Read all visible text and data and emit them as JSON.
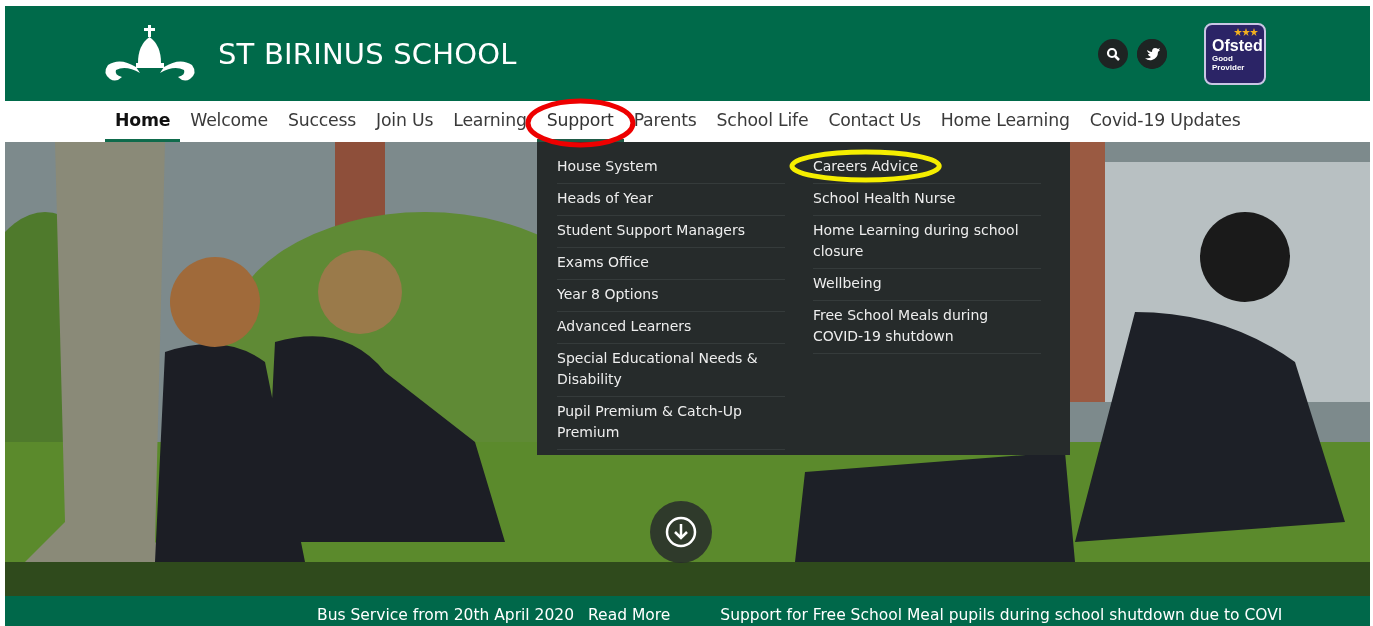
{
  "header": {
    "title": "ST BIRINUS SCHOOL",
    "badge": {
      "name": "Ofsted",
      "rating_line_1": "Good",
      "rating_line_2": "Provider"
    }
  },
  "nav": [
    {
      "label": "Home",
      "selected": true,
      "expanded": false
    },
    {
      "label": "Welcome",
      "selected": false,
      "expanded": false
    },
    {
      "label": "Success",
      "selected": false,
      "expanded": false
    },
    {
      "label": "Join Us",
      "selected": false,
      "expanded": false
    },
    {
      "label": "Learning",
      "selected": false,
      "expanded": false
    },
    {
      "label": "Support",
      "selected": false,
      "expanded": true
    },
    {
      "label": "Parents",
      "selected": false,
      "expanded": false
    },
    {
      "label": "School Life",
      "selected": false,
      "expanded": false
    },
    {
      "label": "Contact Us",
      "selected": false,
      "expanded": false
    },
    {
      "label": "Home Learning",
      "selected": false,
      "expanded": false
    },
    {
      "label": "Covid-19 Updates",
      "selected": false,
      "expanded": false
    }
  ],
  "dropdown": {
    "columns": [
      [
        "House System",
        "Heads of Year",
        "Student Support Managers",
        "Exams Office",
        "Year 8 Options",
        "Advanced Learners",
        "Special Educational Needs & Disability",
        "Pupil Premium & Catch-Up Premium"
      ],
      [
        "Careers Advice",
        "School Health Nurse",
        "Home Learning during school closure",
        "Wellbeing",
        "Free School Meals during COVID-19 shutdown"
      ]
    ]
  },
  "ticker": [
    {
      "text": "Bus Service from 20th April 2020",
      "link": "Read More"
    },
    {
      "text": "Support for Free School Meal pupils during school shutdown due to COVI"
    }
  ],
  "annotations": [
    {
      "kind": "ellipse",
      "color": "#ee0000"
    },
    {
      "kind": "ellipse",
      "color": "#f5ee00"
    }
  ]
}
